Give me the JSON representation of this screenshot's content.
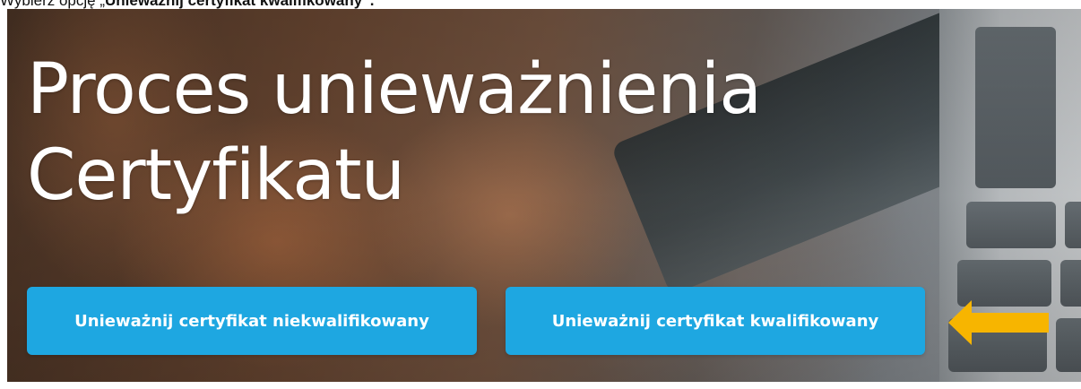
{
  "instruction": {
    "prefix": "Wybierz opcję „",
    "emphasis": "Unieważnij certyfikat kwalifikowany",
    "suffix": "”."
  },
  "hero": {
    "title_line1": "Proces unieważnienia",
    "title_line2": "Certyfikatu",
    "buttons": {
      "non_qualified": "Unieważnij certyfikat niekwalifikowany",
      "qualified": "Unieważnij certyfikat kwalifikowany"
    }
  },
  "colors": {
    "button": "#1ea7e1",
    "arrow": "#f7b500"
  },
  "icons": {
    "arrow": "arrow-left-icon"
  }
}
